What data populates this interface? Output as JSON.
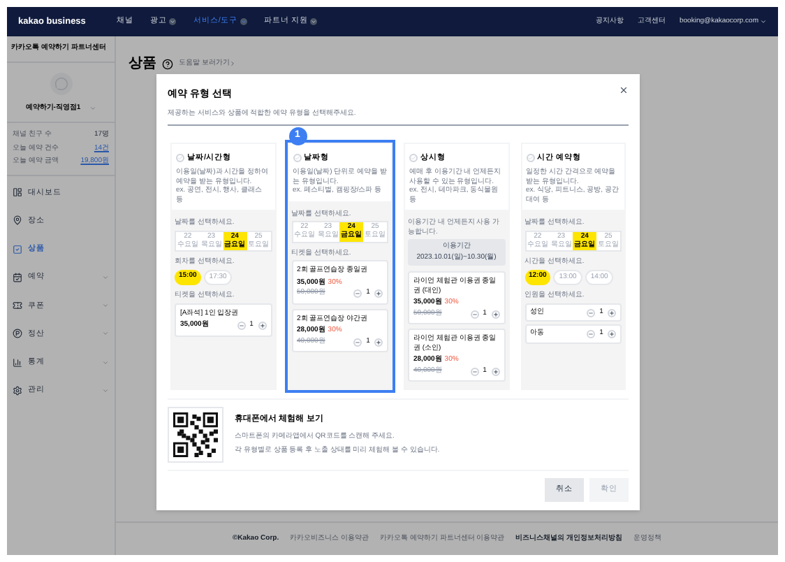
{
  "nav": {
    "logo": "kakao business",
    "items": [
      {
        "label": "채널",
        "dropdown": false,
        "selected": false
      },
      {
        "label": "광고",
        "dropdown": true,
        "selected": false
      },
      {
        "label": "서비스/도구",
        "dropdown": true,
        "selected": true
      },
      {
        "label": "파트너 지원",
        "dropdown": true,
        "selected": false
      }
    ],
    "links": [
      "공지사항",
      "고객센터"
    ],
    "account": "booking@kakaocorp.com"
  },
  "sidebar": {
    "title": "카카오톡 예약하기 파트너센터",
    "profile": "예약하기-직영점1",
    "stats": [
      {
        "label": "채널 친구 수",
        "value": "17명",
        "link": false
      },
      {
        "label": "오늘 예약 건수",
        "value": "14건",
        "link": true
      },
      {
        "label": "오늘 예약 금액",
        "value": "19,800원",
        "link": true
      }
    ],
    "menu": [
      {
        "label": "대시보드",
        "selected": false,
        "expandable": false
      },
      {
        "label": "장소",
        "selected": false,
        "expandable": false
      },
      {
        "label": "상품",
        "selected": true,
        "expandable": false
      },
      {
        "label": "예약",
        "selected": false,
        "expandable": true
      },
      {
        "label": "쿠폰",
        "selected": false,
        "expandable": true
      },
      {
        "label": "정산",
        "selected": false,
        "expandable": true
      },
      {
        "label": "통계",
        "selected": false,
        "expandable": true
      },
      {
        "label": "관리",
        "selected": false,
        "expandable": true
      }
    ]
  },
  "page": {
    "title": "상품",
    "help": "도움말 보러가기"
  },
  "modal": {
    "title": "예약 유형 선택",
    "subtitle": "제공하는 서비스와 상품에 적합한 예약 유형을 선택해주세요.",
    "badge": "1",
    "types": [
      {
        "title": "날짜/시간형",
        "selected": false,
        "description": "이용일(날짜)과 시간을 정하여 예약을 받는 유형입니다.",
        "example": "ex. 공연, 전시, 행사, 클래스 등",
        "sections": [
          {
            "kind": "dates",
            "label": "날짜를 선택하세요.",
            "dates": [
              {
                "day": "22",
                "weekday": "수요일",
                "selected": false
              },
              {
                "day": "23",
                "weekday": "목요일",
                "selected": false
              },
              {
                "day": "24",
                "weekday": "금요일",
                "selected": true
              },
              {
                "day": "25",
                "weekday": "토요일",
                "selected": false
              }
            ]
          },
          {
            "kind": "times",
            "label": "회차를 선택하세요.",
            "times": [
              {
                "label": "15:00",
                "selected": true
              },
              {
                "label": "17:30",
                "selected": false
              }
            ]
          },
          {
            "kind": "tickets",
            "label": "티켓을 선택하세요.",
            "tickets": [
              {
                "name": "[A좌석] 1인 입장권",
                "price": "35,000원",
                "quantity": "1"
              }
            ]
          }
        ]
      },
      {
        "title": "날짜형",
        "selected": true,
        "description": "이용일(날짜) 단위로 예약을 받는 유형입니다.",
        "example": "ex. 페스티벌, 캠핑장/스파 등",
        "sections": [
          {
            "kind": "dates",
            "label": "날짜를 선택하세요.",
            "dates": [
              {
                "day": "22",
                "weekday": "수요일",
                "selected": false
              },
              {
                "day": "23",
                "weekday": "목요일",
                "selected": false
              },
              {
                "day": "24",
                "weekday": "금요일",
                "selected": true
              },
              {
                "day": "25",
                "weekday": "토요일",
                "selected": false
              }
            ]
          },
          {
            "kind": "tickets",
            "label": "티켓을 선택하세요.",
            "tickets": [
              {
                "name": "2회 골프연습장 종일권",
                "price": "35,000원",
                "discount": "30%",
                "original": "50,000원",
                "quantity": "1"
              },
              {
                "name": "2회 골프연습장 야간권",
                "price": "28,000원",
                "discount": "30%",
                "original": "40,000원",
                "quantity": "1"
              }
            ]
          }
        ]
      },
      {
        "title": "상시형",
        "selected": false,
        "description": "예매 후 이용기간 내 언제든지 사용할 수 있는 유형입니다.",
        "example": "ex. 전시, 테마파크, 동식물원 등",
        "sections": [
          {
            "kind": "period",
            "label": "이용기간 내 언제든지 사용 가능합니다.",
            "period_label": "이용기간",
            "period": "2023.10.01(일)~10.30(월)"
          },
          {
            "kind": "tickets",
            "tickets": [
              {
                "name": "라이언 체험관 이용권 종일권 (대인)",
                "price": "35,000원",
                "discount": "30%",
                "original": "50,000원",
                "quantity": "1"
              },
              {
                "name": "라이언 체험관 이용권 종일권 (소인)",
                "price": "28,000원",
                "discount": "30%",
                "original": "40,000원",
                "quantity": "1"
              }
            ]
          }
        ]
      },
      {
        "title": "시간 예약형",
        "selected": false,
        "description": "일정한 시간 간격으로 예약을 받는 유형입니다.",
        "example": "ex. 식당, 피트니스, 공방, 공간대여 등",
        "sections": [
          {
            "kind": "dates",
            "label": "날짜를 선택하세요.",
            "dates": [
              {
                "day": "22",
                "weekday": "수요일",
                "selected": false
              },
              {
                "day": "23",
                "weekday": "목요일",
                "selected": false
              },
              {
                "day": "24",
                "weekday": "금요일",
                "selected": true
              },
              {
                "day": "25",
                "weekday": "토요일",
                "selected": false
              }
            ]
          },
          {
            "kind": "times",
            "label": "시간을 선택하세요.",
            "times": [
              {
                "label": "12:00",
                "selected": true
              },
              {
                "label": "13:00",
                "selected": false
              },
              {
                "label": "14:00",
                "selected": false
              }
            ]
          },
          {
            "kind": "counters",
            "label": "인원을 선택하세요.",
            "rows": [
              {
                "name": "성인",
                "quantity": "1"
              },
              {
                "name": "아동",
                "quantity": "1"
              }
            ]
          }
        ]
      }
    ],
    "qr": {
      "title": "휴대폰에서 체험해 보기",
      "lines": [
        "스마트폰의 카메라앱에서 QR코드를 스캔해 주세요.",
        "각 유형별로 상품 등록 후 노출 상태를 미리 체험해 볼 수 있습니다."
      ]
    },
    "buttons": [
      {
        "label": "취소",
        "disabled": false
      },
      {
        "label": "확인",
        "disabled": true
      }
    ]
  },
  "footer": [
    {
      "label": "©Kakao Corp.",
      "bold": true
    },
    {
      "label": "카카오비즈니스 이용약관",
      "bold": false
    },
    {
      "label": "카카오톡 예약하기 파트너센터 이용약관",
      "bold": false
    },
    {
      "label": "비즈니스채널의 개인정보처리방침",
      "bold": true
    },
    {
      "label": "운영정책",
      "bold": false
    }
  ]
}
